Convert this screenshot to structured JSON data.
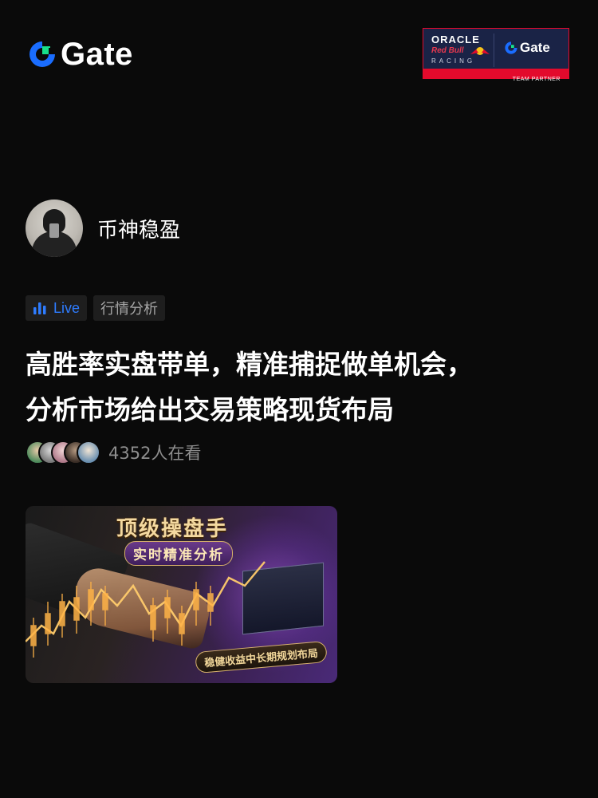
{
  "header": {
    "brand_name": "Gate",
    "brand_color": "#1a6dff",
    "partner_badge": {
      "line1": "ORACLE",
      "line2": "Red Bull",
      "line3": "RACING",
      "gate_label": "Gate",
      "footer": "TEAM PARTNER",
      "accent_color": "#e30a2c",
      "background_color": "#1a2346"
    }
  },
  "author": {
    "name": "币神稳盈",
    "avatar_icon": "avatar-photo"
  },
  "tags": {
    "live_label": "Live",
    "live_icon": "bar-chart-icon",
    "live_color": "#2e7cff",
    "topic_label": "行情分析"
  },
  "post": {
    "title_line1": "高胜率实盘带单，精准捕捉做单机会，",
    "title_line2": "分析市场给出交易策略现货布局"
  },
  "viewers": {
    "count_text": "4352人在看",
    "avatar_count": 5
  },
  "cover": {
    "headline": "顶级操盘手",
    "subheadline": "实时精准分析",
    "ribbon": "稳健收益中长期规划布局"
  }
}
